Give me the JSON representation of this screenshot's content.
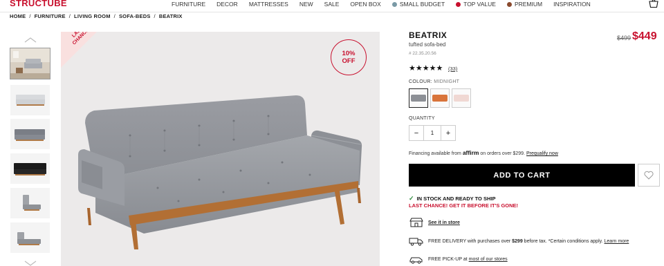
{
  "brand": {
    "logo": "STRUCTUBE"
  },
  "nav": {
    "items": [
      {
        "label": "FURNITURE"
      },
      {
        "label": "DECOR"
      },
      {
        "label": "MATTRESSES"
      },
      {
        "label": "NEW"
      },
      {
        "label": "SALE"
      },
      {
        "label": "OPEN BOX"
      },
      {
        "label": "SMALL BUDGET",
        "dot": "#7a9aa6"
      },
      {
        "label": "TOP VALUE",
        "dot": "#c8102e"
      },
      {
        "label": "PREMIUM",
        "dot": "#8a4a2e"
      },
      {
        "label": "INSPIRATION"
      }
    ]
  },
  "breadcrumb": [
    "HOME",
    "FURNITURE",
    "LIVING ROOM",
    "SOFA-BEDS",
    "BEATRIX"
  ],
  "gallery": {
    "ribbon": "LAST CHANCE!",
    "discount_line1": "10%",
    "discount_line2": "OFF",
    "thumb_count": 6
  },
  "product": {
    "title": "BEATRIX",
    "subtitle": "tufted sofa-bed",
    "sku": "# 22.35.20.56",
    "price_old": "$499",
    "price_new": "$449",
    "rating": 5,
    "review_count": "(33)",
    "colour_label": "COLOUR:",
    "colour_value": "MIDNIGHT",
    "swatches": [
      {
        "name": "midnight",
        "color": "#8c8f95"
      },
      {
        "name": "orange",
        "color": "#d9743a"
      },
      {
        "name": "pink",
        "color": "#f0d8d3"
      }
    ],
    "quantity_label": "QUANTITY",
    "quantity": "1",
    "financing_pre": "Financing available from",
    "financing_brand": "affirm",
    "financing_post": "on orders over $299.",
    "financing_link": "Prequalify now",
    "add_to_cart": "ADD TO CART",
    "stock": "IN STOCK AND READY TO SHIP",
    "last_chance": "LAST CHANCE! GET IT BEFORE IT'S GONE!",
    "see_store": "See it in store",
    "delivery_pre": "FREE DELIVERY with purchases over",
    "delivery_amount": "$299",
    "delivery_post": "before tax. *Certain conditions apply.",
    "delivery_link": "Learn more",
    "pickup_pre": "FREE PICK-UP at",
    "pickup_link": "most of our stores"
  }
}
